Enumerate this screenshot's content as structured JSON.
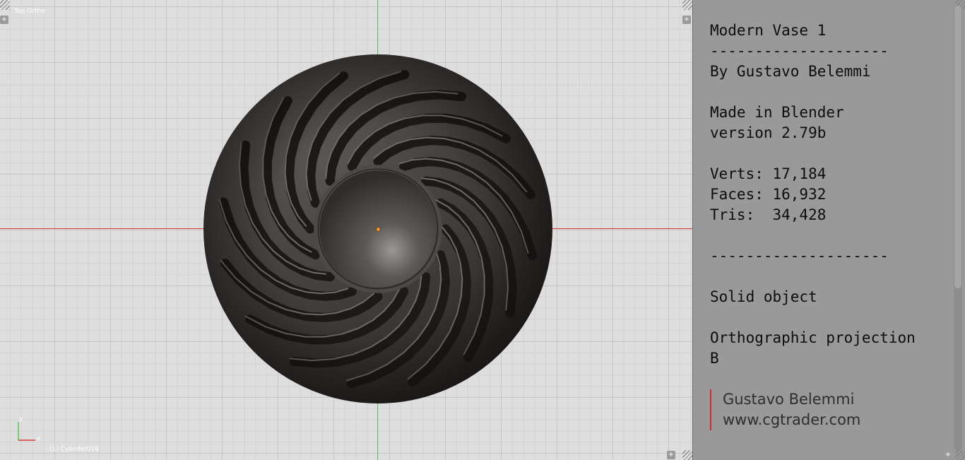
{
  "viewport": {
    "view_name": "Top Ortho",
    "active_object": "(1) Cylinder016",
    "axis_labels": {
      "x": "x",
      "y": "y"
    },
    "colors": {
      "x_axis": "#d9383a",
      "y_axis": "#59c25b",
      "origin": "#f39a3a"
    }
  },
  "text_editor": {
    "lines": [
      "Modern Vase 1",
      "--------------------",
      "By Gustavo Belemmi",
      "",
      "Made in Blender",
      "version 2.79b",
      "",
      "Verts: 17,184",
      "Faces: 16,932",
      "Tris:  34,428",
      "",
      "--------------------",
      "",
      "Solid object",
      "",
      "Orthographic projection",
      "B"
    ],
    "signature": {
      "name": "Gustavo Belemmi",
      "website": "www.cgtrader.com",
      "accent": "#d42a2a"
    }
  }
}
